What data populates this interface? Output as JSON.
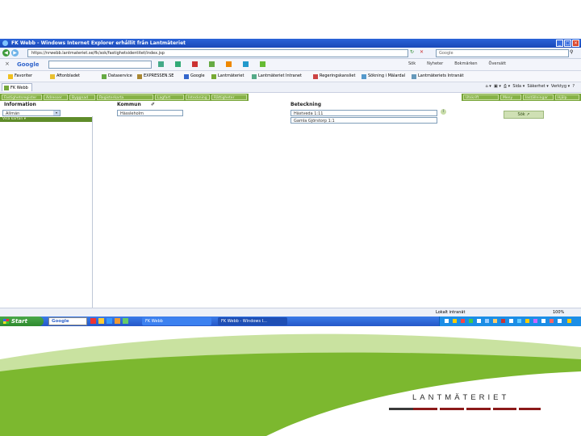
{
  "window": {
    "title": "FK Webb - Windows Internet Explorer erhållit från Lantmäteriet"
  },
  "address_bar": {
    "url": "https://nrwebb.lantmateriet.se/fk/sok/fastighetsidentitet/index.jsp",
    "search_placeholder": "Google"
  },
  "google_bar": {
    "logo": "Google",
    "labels": [
      "Sök",
      "Nyheter",
      "Bokmärken",
      "Översätt"
    ]
  },
  "favorites": {
    "label": "Favoriter",
    "items": [
      "Aftonbladet",
      "Dataservice",
      "EXPRESSEN.SE",
      "Google",
      "Lantmäteriet",
      "Lantmäteriet Intranet",
      "Regeringskansliet",
      "Sökning i Mälardal",
      "Lantmäteriets Intranät"
    ]
  },
  "tab": {
    "label": "FK Webb"
  },
  "commands": [
    "Sida",
    "Säkerhet",
    "Verktyg"
  ],
  "app_toolbar": {
    "left_tabs": [
      "Fastighetsregister",
      "Adresser",
      "Byggnad",
      "Registerkarta",
      "Lagfart",
      "Inteckning",
      "Rättigheter"
    ],
    "right_tabs": [
      "Utskrift",
      "Meny",
      "Inställningar",
      "Hjälp"
    ]
  },
  "form": {
    "information_label": "Information",
    "information_value": "Allmän",
    "kommun_label": "Kommun",
    "kommun_value": "Hässleholm",
    "beteckning_label": "Beteckning",
    "beteckning_value": "Hästveda 1:11",
    "beteckning_value_2": "Gamla Gjörstorp 1:1",
    "side_menu": "Visa kartan",
    "search_button": "Sök"
  },
  "statusbar": {
    "zone": "Lokalt intranät",
    "zoom": "100%"
  },
  "taskbar": {
    "start": "Start",
    "search": "Google",
    "tasks": [
      "FK Webb",
      "FK Webb - Windows I..."
    ]
  },
  "brand": {
    "name": "LANTMÄTERIET"
  },
  "colors": {
    "brand_green": "#7cb82f",
    "ui_green": "#77a43a",
    "xp_blue": "#2a63d8",
    "brand_red": "#8b1a1a"
  }
}
